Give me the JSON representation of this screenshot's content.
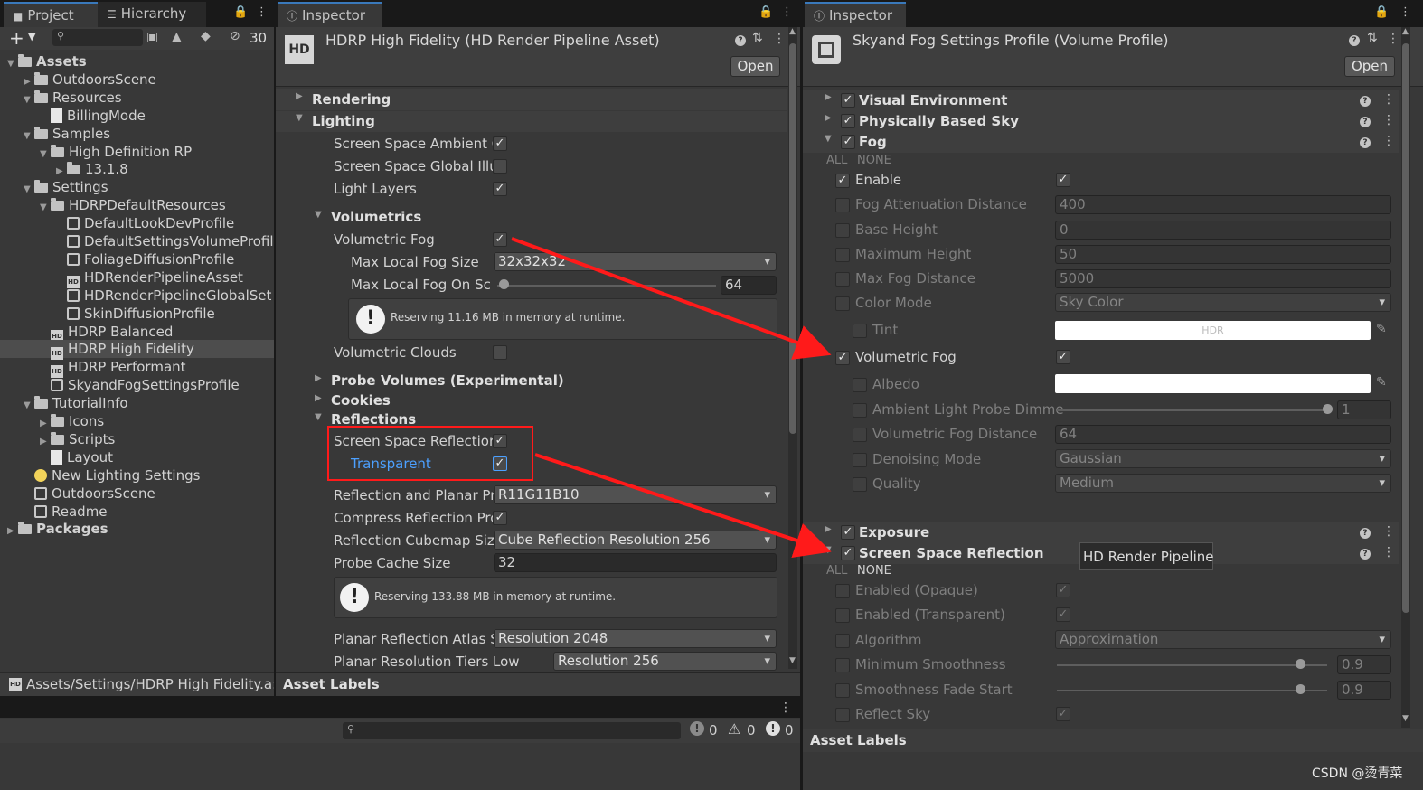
{
  "project_panel": {
    "tab_project": "Project",
    "tab_hierarchy": "Hierarchy",
    "toolbar_count": "30",
    "tree": [
      {
        "label": "Assets",
        "indent": 0,
        "arrow": "▼",
        "icon": "folder",
        "bold": true
      },
      {
        "label": "OutdoorsScene",
        "indent": 1,
        "arrow": "▶",
        "icon": "folder"
      },
      {
        "label": "Resources",
        "indent": 1,
        "arrow": "▼",
        "icon": "folder"
      },
      {
        "label": "BillingMode",
        "indent": 2,
        "arrow": "",
        "icon": "file"
      },
      {
        "label": "Samples",
        "indent": 1,
        "arrow": "▼",
        "icon": "folder"
      },
      {
        "label": "High Definition RP",
        "indent": 2,
        "arrow": "▼",
        "icon": "folder"
      },
      {
        "label": "13.1.8",
        "indent": 3,
        "arrow": "▶",
        "icon": "folder"
      },
      {
        "label": "Settings",
        "indent": 1,
        "arrow": "▼",
        "icon": "folder"
      },
      {
        "label": "HDRPDefaultResources",
        "indent": 2,
        "arrow": "▼",
        "icon": "folder"
      },
      {
        "label": "DefaultLookDevProfile",
        "indent": 3,
        "arrow": "",
        "icon": "cube"
      },
      {
        "label": "DefaultSettingsVolumeProfil",
        "indent": 3,
        "arrow": "",
        "icon": "cube"
      },
      {
        "label": "FoliageDiffusionProfile",
        "indent": 3,
        "arrow": "",
        "icon": "cube"
      },
      {
        "label": "HDRenderPipelineAsset",
        "indent": 3,
        "arrow": "",
        "icon": "hd"
      },
      {
        "label": "HDRenderPipelineGlobalSet",
        "indent": 3,
        "arrow": "",
        "icon": "cube"
      },
      {
        "label": "SkinDiffusionProfile",
        "indent": 3,
        "arrow": "",
        "icon": "cube"
      },
      {
        "label": "HDRP Balanced",
        "indent": 2,
        "arrow": "",
        "icon": "hd"
      },
      {
        "label": "HDRP High Fidelity",
        "indent": 2,
        "arrow": "",
        "icon": "hd",
        "selected": true
      },
      {
        "label": "HDRP Performant",
        "indent": 2,
        "arrow": "",
        "icon": "hd"
      },
      {
        "label": "SkyandFogSettingsProfile",
        "indent": 2,
        "arrow": "",
        "icon": "cube"
      },
      {
        "label": "TutorialInfo",
        "indent": 1,
        "arrow": "▼",
        "icon": "folder"
      },
      {
        "label": "Icons",
        "indent": 2,
        "arrow": "▶",
        "icon": "folder"
      },
      {
        "label": "Scripts",
        "indent": 2,
        "arrow": "▶",
        "icon": "folder"
      },
      {
        "label": "Layout",
        "indent": 2,
        "arrow": "",
        "icon": "file"
      },
      {
        "label": "New Lighting Settings",
        "indent": 1,
        "arrow": "",
        "icon": "bulb"
      },
      {
        "label": "OutdoorsScene",
        "indent": 1,
        "arrow": "",
        "icon": "cube"
      },
      {
        "label": "Readme",
        "indent": 1,
        "arrow": "",
        "icon": "cube"
      },
      {
        "label": "Packages",
        "indent": 0,
        "arrow": "▶",
        "icon": "folder",
        "bold": true
      }
    ],
    "footer_path": "Assets/Settings/HDRP High Fidelity.a:"
  },
  "inspector1": {
    "tab": "Inspector",
    "title": "HDRP High Fidelity (HD Render Pipeline Asset)",
    "open_label": "Open",
    "sections": {
      "rendering": "Rendering",
      "lighting": "Lighting",
      "volumetrics": "Volumetrics",
      "probe_volumes": "Probe Volumes (Experimental)",
      "cookies": "Cookies",
      "reflections": "Reflections"
    },
    "lighting_rows": {
      "ssao": "Screen Space Ambient C",
      "ssgi": "Screen Space Global Illu",
      "light_layers": "Light Layers"
    },
    "volumetric_fog": "Volumetric Fog",
    "max_local_fog_size": "Max Local Fog Size",
    "max_local_fog_size_value": "32x32x32",
    "max_local_fog_on_screen": "Max Local Fog On Sc",
    "max_local_fog_on_screen_value": "64",
    "max_local_fog_on_screen_fraction": 0.03,
    "vol_help": "Reserving 11.16 MB in memory at runtime.",
    "volumetric_clouds": "Volumetric Clouds",
    "ssr_label": "Screen Space Reflectior",
    "transparent_label": "Transparent",
    "reflection_planar": "Reflection and Planar Pr",
    "reflection_planar_value": "R11G11B10",
    "compress_reflection": "Compress Reflection Prc",
    "cubemap_size": "Reflection Cubemap Siz",
    "cubemap_size_value": "Cube Reflection Resolution 256",
    "probe_cache": "Probe Cache Size",
    "probe_cache_value": "32",
    "refl_help": "Reserving 133.88 MB in memory at runtime.",
    "planar_atlas": "Planar Reflection Atlas S",
    "planar_atlas_value": "Resolution 2048",
    "planar_tiers": "Planar Resolution Tiers",
    "planar_tiers_low": "Low",
    "planar_tiers_value": "Resolution 256",
    "asset_labels": "Asset Labels"
  },
  "console": {
    "count_info": "0",
    "count_warn": "0",
    "count_error": "0"
  },
  "inspector2": {
    "tab": "Inspector",
    "title": "Skyand Fog Settings Profile (Volume Profile)",
    "open_label": "Open",
    "visual_environment": "Visual Environment",
    "physically_based_sky": "Physically Based Sky",
    "fog": "Fog",
    "all": "ALL",
    "none": "NONE",
    "enable": "Enable",
    "fog_attenuation": "Fog Attenuation Distance",
    "fog_attenuation_value": "400",
    "base_height": "Base Height",
    "base_height_value": "0",
    "maximum_height": "Maximum Height",
    "maximum_height_value": "50",
    "max_fog_distance": "Max Fog Distance",
    "max_fog_distance_value": "5000",
    "color_mode": "Color Mode",
    "color_mode_value": "Sky Color",
    "tint": "Tint",
    "tint_hdr": "HDR",
    "volumetric_fog": "Volumetric Fog",
    "albedo": "Albedo",
    "ambient_probe": "Ambient Light Probe Dimme",
    "ambient_probe_value": "1",
    "ambient_probe_fraction": 1.0,
    "vol_fog_distance": "Volumetric Fog Distance",
    "vol_fog_distance_value": "64",
    "denoising": "Denoising Mode",
    "denoising_value": "Gaussian",
    "quality": "Quality",
    "quality_value": "Medium",
    "exposure": "Exposure",
    "ssr": "Screen Space Reflection",
    "tooltip": "HD Render Pipeline",
    "enabled_opaque": "Enabled (Opaque)",
    "enabled_transparent": "Enabled (Transparent)",
    "algorithm": "Algorithm",
    "algorithm_value": "Approximation",
    "min_smoothness": "Minimum Smoothness",
    "min_smoothness_value": "0.9",
    "min_smoothness_fraction": 0.9,
    "smooth_fade": "Smoothness Fade Start",
    "smooth_fade_value": "0.9",
    "smooth_fade_fraction": 0.9,
    "reflect_sky": "Reflect Sky",
    "asset_labels": "Asset Labels"
  },
  "watermark": "CSDN @烫青菜",
  "colors": {
    "annotation": "#ff1a1a",
    "link": "#4ca0ff",
    "accent": "#3a79bb"
  }
}
